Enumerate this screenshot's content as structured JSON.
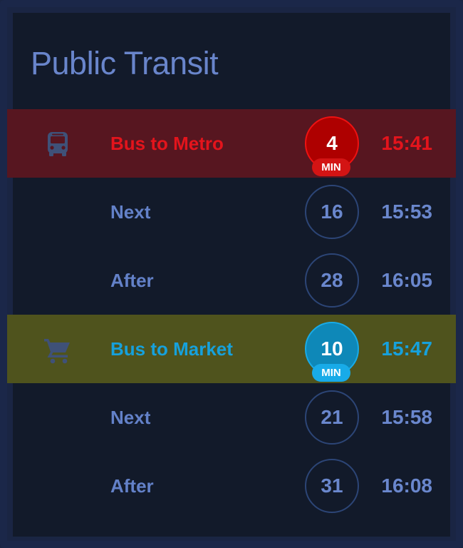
{
  "title": "Public Transit",
  "minute_badge": "MIN",
  "colors": {
    "background": "#1a2543",
    "card": "#121a2a",
    "title": "#6985cb",
    "text": "#6381c8",
    "route1_highlight": "#571620",
    "route1_accent": "#e3141c",
    "route2_highlight": "#4f531d",
    "route2_accent": "#16a1dc"
  },
  "routes": [
    {
      "name": "Bus to Metro",
      "icon": "bus-icon",
      "departures": [
        {
          "label": "Bus to Metro",
          "minutes": "4",
          "time": "15:41"
        },
        {
          "label": "Next",
          "minutes": "16",
          "time": "15:53"
        },
        {
          "label": "After",
          "minutes": "28",
          "time": "16:05"
        }
      ]
    },
    {
      "name": "Bus to Market",
      "icon": "shopping-cart-icon",
      "departures": [
        {
          "label": "Bus to Market",
          "minutes": "10",
          "time": "15:47"
        },
        {
          "label": "Next",
          "minutes": "21",
          "time": "15:58"
        },
        {
          "label": "After",
          "minutes": "31",
          "time": "16:08"
        }
      ]
    }
  ]
}
